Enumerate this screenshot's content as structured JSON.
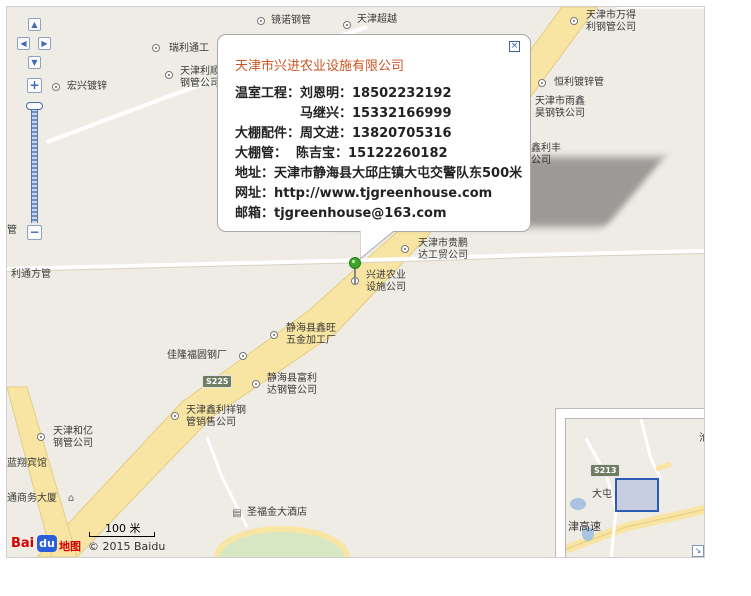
{
  "map": {
    "poi_labels": [
      "镜诺钢管",
      "天津超越",
      "天津市万得\n利钢管公司",
      "瑞利通工",
      "天津利顺\n钢管公司",
      "宏兴镀锌",
      "恒利镀锌管",
      "天津市雨鑫\n昊钢铁公司",
      "鑫利丰\n公司",
      "天津市贵鹏\n达工贸公司",
      "兴进农业\n设施公司",
      "静海县鑫旺\n五金加工厂",
      "佳隆福圆钢厂",
      "静海县富利\n达钢管公司",
      "天津鑫利祥钢\n管销售公司",
      "天津和亿\n钢管公司",
      "蓝翔宾馆",
      "通商务大厦",
      "圣福金大酒店"
    ],
    "edge_labels": [
      "管",
      "利通方管"
    ],
    "road_shield": "S225",
    "colors": {
      "road": "#f9e5a3",
      "road_edge": "#e5cc82",
      "land": "#efece6",
      "title": "#cc5522"
    }
  },
  "nav": {
    "up_icon": "▲",
    "down_icon": "▼",
    "left_icon": "◀",
    "right_icon": "▶",
    "zoom_in": "+",
    "zoom_out": "−"
  },
  "info_window": {
    "title": "天津市兴进农业设施有限公司",
    "close_icon": "×",
    "lines": [
      "温室工程：刘恩明：18502232192",
      "马继兴：15332166999",
      "大棚配件：周文进：13820705316",
      "大棚管：  陈吉宝：15122260182",
      "地址：天津市静海县大邱庄镇大屯交警队东500米",
      "网址：http://www.tjgreenhouse.com",
      "邮箱：tjgreenhouse@163.com"
    ]
  },
  "overview": {
    "labels": [
      "S213",
      "大屯",
      "津高速",
      "沧"
    ],
    "toggle_icon": "↘"
  },
  "scale": {
    "label": "100 米"
  },
  "brand": {
    "logo_text": "Bai",
    "logo_mid": "du",
    "logo_suffix": "地图",
    "copyright": "© 2015 Baidu"
  }
}
